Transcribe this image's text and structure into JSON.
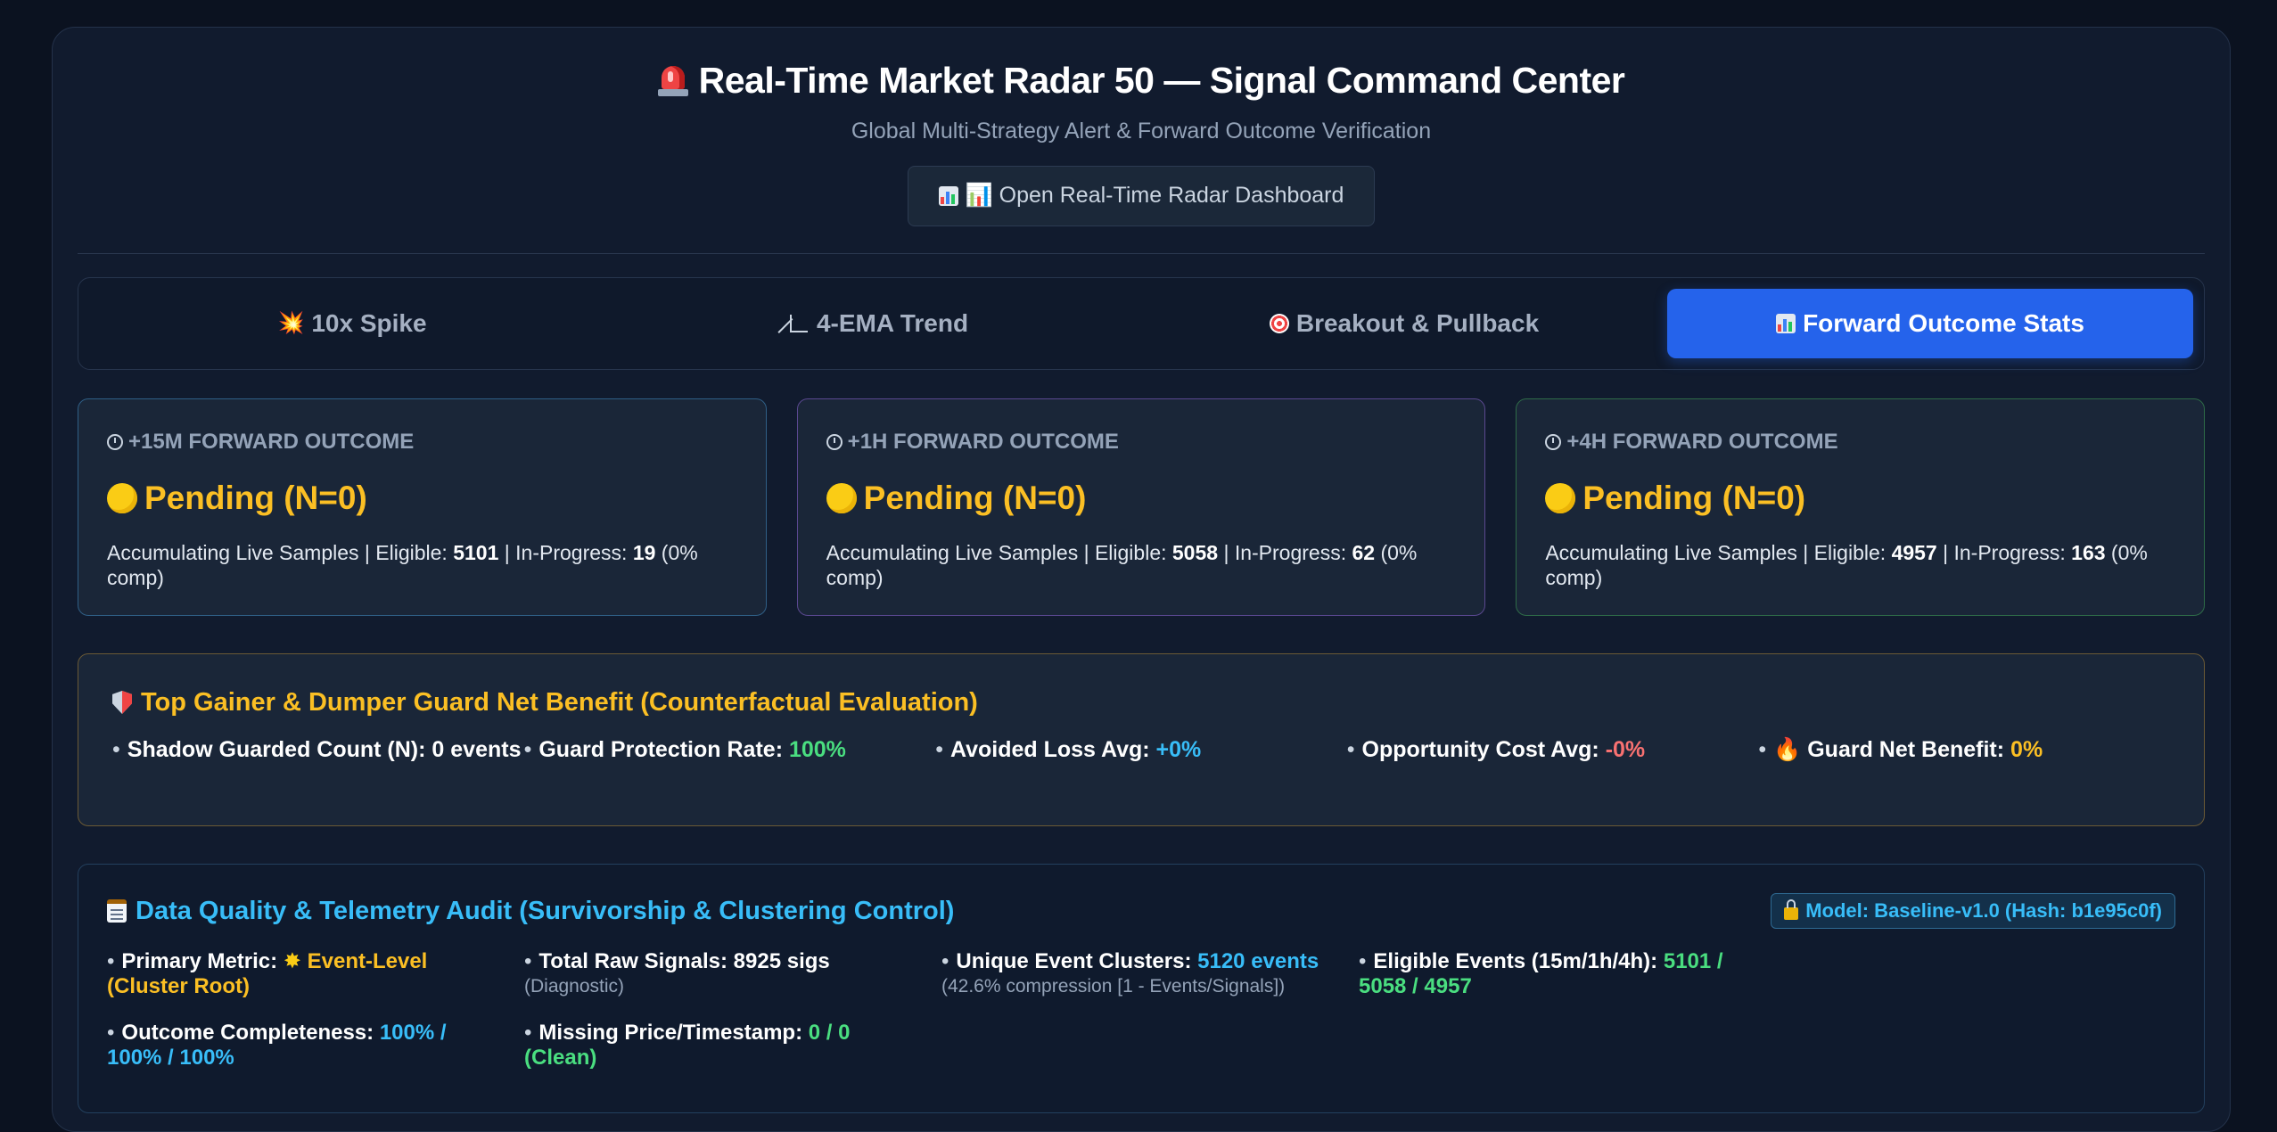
{
  "header": {
    "title": "Real-Time Market Radar 50 — Signal Command Center",
    "subtitle": "Global Multi-Strategy Alert & Forward Outcome Verification",
    "open_button": "📊 Open Real-Time Radar Dashboard"
  },
  "tabs": [
    {
      "icon": "💥",
      "label": "10x Spike",
      "active": false
    },
    {
      "icon": "triangle-ruler",
      "label": "4-EMA Trend",
      "active": false
    },
    {
      "icon": "target",
      "label": "Breakout & Pullback",
      "active": false
    },
    {
      "icon": "bar-chart",
      "label": "Forward Outcome Stats",
      "active": true
    }
  ],
  "outcomes": [
    {
      "label": "+15M FORWARD OUTCOME",
      "status": "Pending (N=0)",
      "prefix": "Accumulating Live Samples | Eligible: ",
      "eligible": "5101",
      "mid": " | In-Progress: ",
      "in_progress": "19",
      "suffix": " (0% comp)"
    },
    {
      "label": "+1H FORWARD OUTCOME",
      "status": "Pending (N=0)",
      "prefix": "Accumulating Live Samples | Eligible: ",
      "eligible": "5058",
      "mid": " | In-Progress: ",
      "in_progress": "62",
      "suffix": " (0% comp)"
    },
    {
      "label": "+4H FORWARD OUTCOME",
      "status": "Pending (N=0)",
      "prefix": "Accumulating Live Samples | Eligible: ",
      "eligible": "4957",
      "mid": " | In-Progress: ",
      "in_progress": "163",
      "suffix": " (0% comp)"
    }
  ],
  "guard": {
    "title": "Top Gainer & Dumper Guard Net Benefit (Counterfactual Evaluation)",
    "metrics": [
      {
        "label": "Shadow Guarded Count (N)",
        "value": "0 events",
        "color": "#ffffff"
      },
      {
        "label": "Guard Protection Rate",
        "value": "100%",
        "color": "#4ade80"
      },
      {
        "label": "Avoided Loss Avg",
        "value": "+0%",
        "color": "#38bdf8"
      },
      {
        "label": "Opportunity Cost Avg",
        "value": "-0%",
        "color": "#f87171"
      },
      {
        "label": "Guard Net Benefit",
        "value": "0%",
        "color": "#fbbf24"
      }
    ]
  },
  "data_quality": {
    "title": "Data Quality & Telemetry Audit (Survivorship & Clustering Control)",
    "badge": "Model: Baseline-v1.0 (Hash: b1e95c0f)",
    "items": [
      {
        "label": "Primary Metric",
        "value": "Event-Level (Cluster Root)",
        "note": ""
      },
      {
        "label": "Total Raw Signals",
        "value": "8925 sigs",
        "note": "(Diagnostic)"
      },
      {
        "label": "Unique Event Clusters",
        "value": "5120 events",
        "note": "(42.6% compression [1 - Events/Signals])"
      },
      {
        "label": "Eligible Events (15m/1h/4h)",
        "value": "5101 / 5058 / 4957",
        "note": ""
      },
      {
        "label": "Outcome Completeness",
        "value": "100% / 100% / 100%",
        "note": ""
      },
      {
        "label": "Missing Price/Timestamp",
        "value": "0 / 0 (Clean)",
        "note": ""
      }
    ]
  }
}
